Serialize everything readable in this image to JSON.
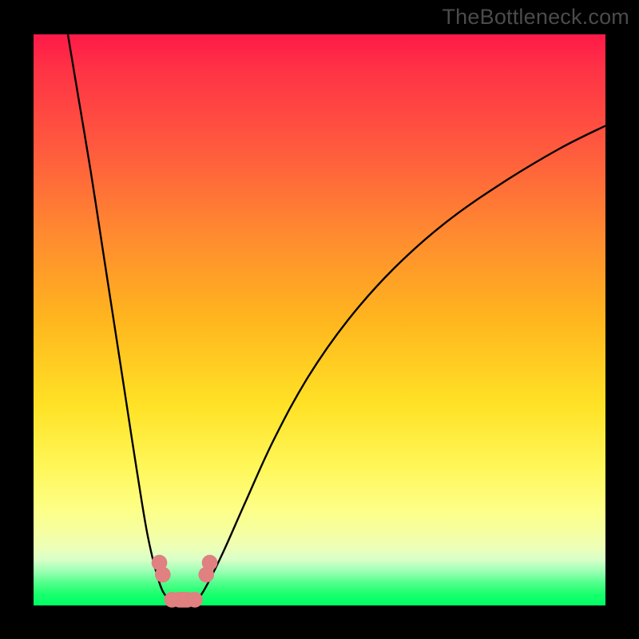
{
  "watermark": "TheBottleneck.com",
  "chart_data": {
    "type": "line",
    "title": "",
    "xlabel": "",
    "ylabel": "",
    "xlim": [
      0,
      100
    ],
    "ylim": [
      0,
      100
    ],
    "grid": false,
    "series": [
      {
        "name": "left-curve",
        "x": [
          6,
          8,
          10,
          12,
          14,
          16,
          18,
          20,
          22,
          23.5,
          25
        ],
        "y": [
          100,
          88,
          76,
          63,
          50,
          37,
          24,
          12,
          4,
          1.2,
          0
        ]
      },
      {
        "name": "right-curve",
        "x": [
          28,
          30,
          33,
          37,
          42,
          48,
          55,
          63,
          72,
          82,
          92,
          100
        ],
        "y": [
          0,
          3,
          9,
          18,
          29,
          40,
          50,
          59,
          67,
          74,
          80,
          84
        ]
      }
    ],
    "markers": [
      {
        "name": "left-marker-upper",
        "cx": 22.0,
        "cy": 7.5,
        "r": 1.3
      },
      {
        "name": "left-marker-lower",
        "cx": 22.6,
        "cy": 5.4,
        "r": 1.3
      },
      {
        "name": "right-marker-upper",
        "cx": 30.8,
        "cy": 7.5,
        "r": 1.3
      },
      {
        "name": "right-marker-lower",
        "cx": 30.2,
        "cy": 5.4,
        "r": 1.3
      },
      {
        "name": "bottom-bar-left",
        "cx": 24.2,
        "cy": 1.0,
        "r": 1.3
      },
      {
        "name": "bottom-bar-right",
        "cx": 28.2,
        "cy": 1.0,
        "r": 1.3
      }
    ],
    "bottom_bar": {
      "x1": 24.2,
      "x2": 28.2,
      "y": 1.0,
      "thickness": 2.6
    }
  }
}
